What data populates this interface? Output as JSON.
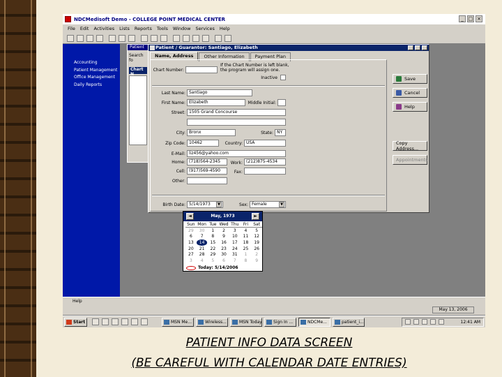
{
  "app": {
    "title": "NDCMedisoft Demo - COLLEGE POINT MEDICAL CENTER"
  },
  "menu": [
    "File",
    "Edit",
    "Activities",
    "Lists",
    "Reports",
    "Tools",
    "Window",
    "Services",
    "Help"
  ],
  "sidebar": {
    "items": [
      "Accounting",
      "Patient Management",
      "Office Management",
      "Daily Reports"
    ]
  },
  "bg_window": {
    "title": "Patient",
    "search_label": "Search fo",
    "list_header": "Chart N"
  },
  "patient": {
    "title": "Patient / Guarantor: Santiago, Elizabeth",
    "tabs": [
      "Name, Address",
      "Other Information",
      "Payment Plan"
    ],
    "chart_number_label": "Chart Number:",
    "chart_note": "If the Chart Number is left blank, the program will assign one.",
    "inactive_label": "Inactive",
    "last_name_label": "Last Name:",
    "last_name": "Santiago",
    "first_name_label": "First Name:",
    "first_name": "Elizabeth",
    "middle_initial_label": "Middle Initial:",
    "street_label": "Street:",
    "street": "1505 Grand Concourse",
    "city_label": "City:",
    "city": "Bronx",
    "state_label": "State:",
    "state": "NY",
    "zip_label": "Zip Code:",
    "zip": "10462",
    "country_label": "Country:",
    "country": "USA",
    "email_label": "E-Mail:",
    "email": "liz456@yahoo.com",
    "home_label": "Home:",
    "home": "(718)564-2345",
    "work_label": "Work:",
    "work": "(212)875-4534",
    "cell_label": "Cell:",
    "cell": "(917)569-4590",
    "fax_label": "Fax:",
    "other_label": "Other:",
    "birth_label": "Birth Date:",
    "birth": "5/14/1973",
    "sex_label": "Sex:",
    "sex": "Female"
  },
  "buttons": {
    "save": "Save",
    "cancel": "Cancel",
    "help": "Help",
    "copy_address": "Copy Address...",
    "appointments": "Appointments"
  },
  "calendar": {
    "month": "May, 1973",
    "days": [
      "Sun",
      "Mon",
      "Tue",
      "Wed",
      "Thu",
      "Fri",
      "Sat"
    ],
    "weeks": [
      [
        "29",
        "30",
        "1",
        "2",
        "3",
        "4",
        "5"
      ],
      [
        "6",
        "7",
        "8",
        "9",
        "10",
        "11",
        "12"
      ],
      [
        "13",
        "14",
        "15",
        "16",
        "17",
        "18",
        "19"
      ],
      [
        "20",
        "21",
        "22",
        "23",
        "24",
        "25",
        "26"
      ],
      [
        "27",
        "28",
        "29",
        "30",
        "31",
        "1",
        "2"
      ],
      [
        "3",
        "4",
        "5",
        "6",
        "7",
        "8",
        "9"
      ]
    ],
    "selected_day": "14",
    "today": "Today: 5/14/2006"
  },
  "status": {
    "help": "Help",
    "date": "May 13, 2006"
  },
  "taskbar": {
    "start": "Start",
    "items": [
      "MSN Me...",
      "Wireless...",
      "MSN Today",
      "Sign In ...",
      "NDCMe...",
      "patient_i..."
    ],
    "clock": "12:41 AM"
  },
  "caption": {
    "line1": "PATIENT INFO DATA SCREEN",
    "line2": "(BE CAREFUL WITH CALENDAR DATE ENTRIES)"
  }
}
